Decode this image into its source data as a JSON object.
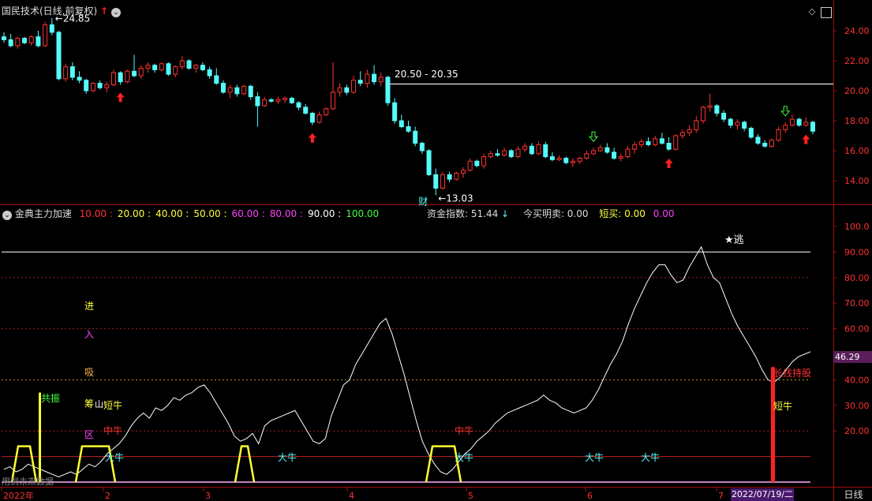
{
  "header": {
    "title": "国民技术(日线,前复权)",
    "price_info": "20.50 - 20.35"
  },
  "price_axis": [
    "24.00",
    "22.00",
    "20.00",
    "18.00",
    "16.00",
    "14.00"
  ],
  "price_labels": {
    "high": "24.85",
    "low": "13.03",
    "cai": "财"
  },
  "indicator": {
    "name": "金典主力加速",
    "params": [
      {
        "text": "10.00",
        "color": "#ff3030"
      },
      {
        "text": "20.00",
        "color": "#ffff40"
      },
      {
        "text": "40.00",
        "color": "#ffff40"
      },
      {
        "text": "50.00",
        "color": "#ffff40"
      },
      {
        "text": "60.00",
        "color": "#ff40ff"
      },
      {
        "text": "80.00",
        "color": "#ff40ff"
      },
      {
        "text": "90.00",
        "color": "#ffffff"
      },
      {
        "text": "100.00",
        "color": "#40ff40"
      }
    ],
    "funds_label": "资金指数: 51.44",
    "today_label": "今买明卖: 0.00",
    "short_label": "短买: 0.00",
    "short_val2": "0.00",
    "current_value": "46.29"
  },
  "indicator_axis": [
    "100.0",
    "90.00",
    "80.00",
    "70.00",
    "60.00",
    "50.00",
    "40.00",
    "30.00",
    "20.00"
  ],
  "indicator_text": {
    "escape": "★逃",
    "jin": "进",
    "ru": "入",
    "xi": "吸",
    "chou": "筹",
    "qu": "区",
    "gong_zhen": "共振",
    "duan_niu": "短牛",
    "zhong_niu": "中牛",
    "da_niu": "大牛",
    "hold": "长线持股",
    "paren": "山",
    "watermark_note": "用到未来数据"
  },
  "time_axis": {
    "labels": [
      "2022年",
      "2",
      "3",
      "4",
      "5",
      "6",
      "7"
    ],
    "current_date": "2022/07/19/二",
    "period": "日线"
  },
  "colors": {
    "up": "#ff3232",
    "down": "#54fcfc",
    "grid_red": "#a01010",
    "white_line": "#ffffff"
  },
  "chart_data": {
    "type": "candlestick",
    "ohlc": [
      [
        23.6,
        23.9,
        23.2,
        23.4
      ],
      [
        23.4,
        23.8,
        22.9,
        23.0
      ],
      [
        23.0,
        23.6,
        22.8,
        23.5
      ],
      [
        23.5,
        23.6,
        23.1,
        23.2
      ],
      [
        23.2,
        23.7,
        23.0,
        23.6
      ],
      [
        23.6,
        24.0,
        22.9,
        23.0
      ],
      [
        23.0,
        24.6,
        22.9,
        24.4
      ],
      [
        24.4,
        24.85,
        23.7,
        23.9
      ],
      [
        23.9,
        24.0,
        20.7,
        20.8
      ],
      [
        20.8,
        21.8,
        20.6,
        21.6
      ],
      [
        21.6,
        21.9,
        20.7,
        20.9
      ],
      [
        20.9,
        21.3,
        20.5,
        20.7
      ],
      [
        20.7,
        20.8,
        19.8,
        20.0
      ],
      [
        20.0,
        20.6,
        19.9,
        20.5
      ],
      [
        20.5,
        20.7,
        20.1,
        20.2
      ],
      [
        20.2,
        20.6,
        19.9,
        20.4
      ],
      [
        20.4,
        21.4,
        20.3,
        21.2
      ],
      [
        21.2,
        21.3,
        20.4,
        20.6
      ],
      [
        20.6,
        21.4,
        20.5,
        21.3
      ],
      [
        21.3,
        22.4,
        20.9,
        21.0
      ],
      [
        21.0,
        21.7,
        20.8,
        21.5
      ],
      [
        21.5,
        21.9,
        21.2,
        21.7
      ],
      [
        21.7,
        21.8,
        21.2,
        21.4
      ],
      [
        21.4,
        21.9,
        21.3,
        21.8
      ],
      [
        21.8,
        21.9,
        21.0,
        21.1
      ],
      [
        21.1,
        21.7,
        20.9,
        21.6
      ],
      [
        21.6,
        22.3,
        21.4,
        22.0
      ],
      [
        22.0,
        22.1,
        21.4,
        21.5
      ],
      [
        21.5,
        21.8,
        21.2,
        21.7
      ],
      [
        21.7,
        21.9,
        21.3,
        21.4
      ],
      [
        21.4,
        21.6,
        20.8,
        21.0
      ],
      [
        21.0,
        21.5,
        20.4,
        20.5
      ],
      [
        20.5,
        20.7,
        19.8,
        19.9
      ],
      [
        19.9,
        20.4,
        19.5,
        20.2
      ],
      [
        20.2,
        20.4,
        19.6,
        19.8
      ],
      [
        19.8,
        20.4,
        19.7,
        20.3
      ],
      [
        20.3,
        20.4,
        19.4,
        19.6
      ],
      [
        19.6,
        19.9,
        17.6,
        19.0
      ],
      [
        19.0,
        19.6,
        18.9,
        19.4
      ],
      [
        19.4,
        19.5,
        19.2,
        19.3
      ],
      [
        19.3,
        19.6,
        19.1,
        19.4
      ],
      [
        19.4,
        19.6,
        19.2,
        19.5
      ],
      [
        19.5,
        19.6,
        19.1,
        19.2
      ],
      [
        19.2,
        19.3,
        18.7,
        18.9
      ],
      [
        18.9,
        19.1,
        18.4,
        18.5
      ],
      [
        18.5,
        18.6,
        17.7,
        17.9
      ],
      [
        17.9,
        18.6,
        17.8,
        18.4
      ],
      [
        18.4,
        18.9,
        18.3,
        18.8
      ],
      [
        18.8,
        21.9,
        18.7,
        19.9
      ],
      [
        19.9,
        20.5,
        19.6,
        20.2
      ],
      [
        20.2,
        20.4,
        19.7,
        19.9
      ],
      [
        19.9,
        21.0,
        19.8,
        20.7
      ],
      [
        20.7,
        21.3,
        20.3,
        20.5
      ],
      [
        20.5,
        21.4,
        20.2,
        21.1
      ],
      [
        21.1,
        21.7,
        20.4,
        20.6
      ],
      [
        20.6,
        21.2,
        20.3,
        20.9
      ],
      [
        20.9,
        21.0,
        19.0,
        19.2
      ],
      [
        19.2,
        19.5,
        17.8,
        18.0
      ],
      [
        18.0,
        18.4,
        17.5,
        17.6
      ],
      [
        17.6,
        18.0,
        17.2,
        17.3
      ],
      [
        17.3,
        17.6,
        16.3,
        16.5
      ],
      [
        16.5,
        16.6,
        15.8,
        16.0
      ],
      [
        16.0,
        16.1,
        14.3,
        14.4
      ],
      [
        14.4,
        14.8,
        13.03,
        13.5
      ],
      [
        13.5,
        14.6,
        13.4,
        14.4
      ],
      [
        14.4,
        14.6,
        13.9,
        14.1
      ],
      [
        14.1,
        14.6,
        14.0,
        14.5
      ],
      [
        14.5,
        14.9,
        14.2,
        14.7
      ],
      [
        14.7,
        15.5,
        14.6,
        15.3
      ],
      [
        15.3,
        15.4,
        14.9,
        15.0
      ],
      [
        15.0,
        15.8,
        14.8,
        15.6
      ],
      [
        15.6,
        16.0,
        15.5,
        15.8
      ],
      [
        15.8,
        16.1,
        15.6,
        15.7
      ],
      [
        15.7,
        16.2,
        15.6,
        16.0
      ],
      [
        16.0,
        16.1,
        15.5,
        15.6
      ],
      [
        15.6,
        16.3,
        15.5,
        16.1
      ],
      [
        16.1,
        16.5,
        15.9,
        16.3
      ],
      [
        16.3,
        16.5,
        15.7,
        15.8
      ],
      [
        15.8,
        16.6,
        15.7,
        16.4
      ],
      [
        16.4,
        16.6,
        15.5,
        15.6
      ],
      [
        15.6,
        15.9,
        15.3,
        15.4
      ],
      [
        15.4,
        15.7,
        15.3,
        15.5
      ],
      [
        15.5,
        15.6,
        15.1,
        15.2
      ],
      [
        15.2,
        15.5,
        14.9,
        15.3
      ],
      [
        15.3,
        15.6,
        15.1,
        15.5
      ],
      [
        15.5,
        16.0,
        15.4,
        15.8
      ],
      [
        15.8,
        16.2,
        15.7,
        16.0
      ],
      [
        16.0,
        16.4,
        15.9,
        16.2
      ],
      [
        16.2,
        16.5,
        15.8,
        15.9
      ],
      [
        15.9,
        16.2,
        15.4,
        15.5
      ],
      [
        15.5,
        15.8,
        15.3,
        15.6
      ],
      [
        15.6,
        16.3,
        15.5,
        16.1
      ],
      [
        16.1,
        16.6,
        15.8,
        16.4
      ],
      [
        16.4,
        16.8,
        16.2,
        16.6
      ],
      [
        16.6,
        16.9,
        16.3,
        16.4
      ],
      [
        16.4,
        17.0,
        16.3,
        16.8
      ],
      [
        16.8,
        17.2,
        16.4,
        16.5
      ],
      [
        16.5,
        16.9,
        16.0,
        16.1
      ],
      [
        16.1,
        17.1,
        16.0,
        17.0
      ],
      [
        17.0,
        17.4,
        16.8,
        17.2
      ],
      [
        17.2,
        17.7,
        17.0,
        17.4
      ],
      [
        17.4,
        18.3,
        17.2,
        18.0
      ],
      [
        18.0,
        19.0,
        17.8,
        18.9
      ],
      [
        18.9,
        19.8,
        18.6,
        19.0
      ],
      [
        19.0,
        19.1,
        18.3,
        18.5
      ],
      [
        18.5,
        18.7,
        17.9,
        18.1
      ],
      [
        18.1,
        18.2,
        17.5,
        17.7
      ],
      [
        17.7,
        18.1,
        17.4,
        17.9
      ],
      [
        17.9,
        18.0,
        17.3,
        17.5
      ],
      [
        17.5,
        17.6,
        16.8,
        16.9
      ],
      [
        16.9,
        17.1,
        16.4,
        16.5
      ],
      [
        16.5,
        16.7,
        16.2,
        16.3
      ],
      [
        16.3,
        16.8,
        16.2,
        16.7
      ],
      [
        16.7,
        17.6,
        16.6,
        17.4
      ],
      [
        17.4,
        17.9,
        17.2,
        17.7
      ],
      [
        17.7,
        18.4,
        17.6,
        18.1
      ],
      [
        18.1,
        18.2,
        17.6,
        17.7
      ],
      [
        17.7,
        18.2,
        17.6,
        17.9
      ],
      [
        17.9,
        18.0,
        17.1,
        17.3
      ]
    ],
    "indicator_line": [
      5,
      6,
      4,
      5,
      7,
      6,
      5,
      4,
      3,
      2,
      3,
      4,
      3,
      5,
      7,
      6,
      8,
      11,
      13,
      15,
      18,
      22,
      25,
      27,
      25,
      29,
      28,
      30,
      33,
      32,
      34,
      35,
      37,
      38,
      35,
      31,
      27,
      23,
      18,
      16,
      17,
      19,
      15,
      22,
      24,
      25,
      26,
      27,
      28,
      24,
      20,
      16,
      15,
      17,
      26,
      32,
      38,
      40,
      46,
      50,
      54,
      58,
      62,
      64,
      58,
      50,
      42,
      33,
      24,
      16,
      11,
      7,
      4,
      3,
      5,
      8,
      11,
      13,
      16,
      18,
      20,
      23,
      25,
      27,
      28,
      29,
      30,
      31,
      32,
      34,
      32,
      31,
      29,
      28,
      27,
      28,
      29,
      32,
      36,
      41,
      46,
      50,
      55,
      62,
      68,
      73,
      78,
      82,
      85,
      85,
      81,
      78,
      79,
      84,
      88,
      92,
      85,
      80,
      78,
      72,
      66,
      61,
      57,
      53,
      49,
      44,
      40,
      39,
      41,
      44,
      47,
      49,
      50,
      51
    ],
    "yaxis_price": [
      13,
      25
    ],
    "yaxis_indicator": [
      0,
      100
    ]
  }
}
